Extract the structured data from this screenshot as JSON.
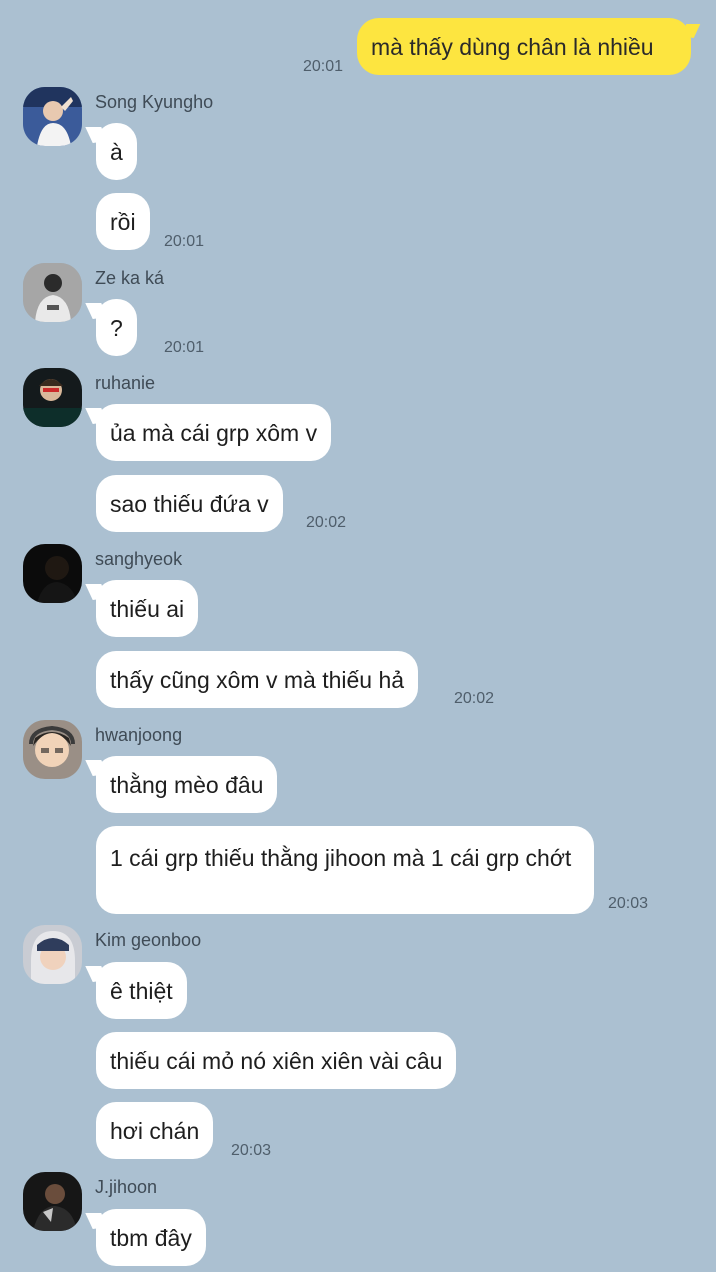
{
  "chat": {
    "my_message": {
      "text": "mà thấy dùng chân là nhiều",
      "time": "20:01"
    },
    "groups": [
      {
        "sender": "Song Kyungho",
        "avatar": "profile-photo-icon",
        "messages": [
          "à",
          "rồi"
        ],
        "time": "20:01"
      },
      {
        "sender": "Ze ka ká",
        "avatar": "profile-photo-icon",
        "messages": [
          "?"
        ],
        "time": "20:01"
      },
      {
        "sender": "ruhanie",
        "avatar": "profile-photo-icon",
        "messages": [
          "ủa mà cái grp xôm v",
          "sao thiếu đứa v"
        ],
        "time": "20:02"
      },
      {
        "sender": "sanghyeok",
        "avatar": "profile-photo-icon",
        "messages": [
          "thiếu ai",
          "thấy cũng xôm v mà thiếu hả"
        ],
        "time": "20:02"
      },
      {
        "sender": "hwanjoong",
        "avatar": "profile-photo-icon",
        "messages": [
          "thằng mèo đâu",
          "1 cái grp thiếu thằng jihoon mà 1 cái grp chớt"
        ],
        "time": "20:03"
      },
      {
        "sender": "Kim geonboo",
        "avatar": "profile-photo-icon",
        "messages": [
          "ê thiệt",
          "thiếu cái mỏ nó xiên xiên vài câu",
          "hơi chán"
        ],
        "time": "20:03"
      },
      {
        "sender": "J.jihoon",
        "avatar": "profile-photo-icon",
        "messages": [
          "tbm đây"
        ]
      }
    ]
  },
  "colors": {
    "background": "#abc0d1",
    "my_bubble": "#fde540",
    "other_bubble": "#ffffff"
  }
}
